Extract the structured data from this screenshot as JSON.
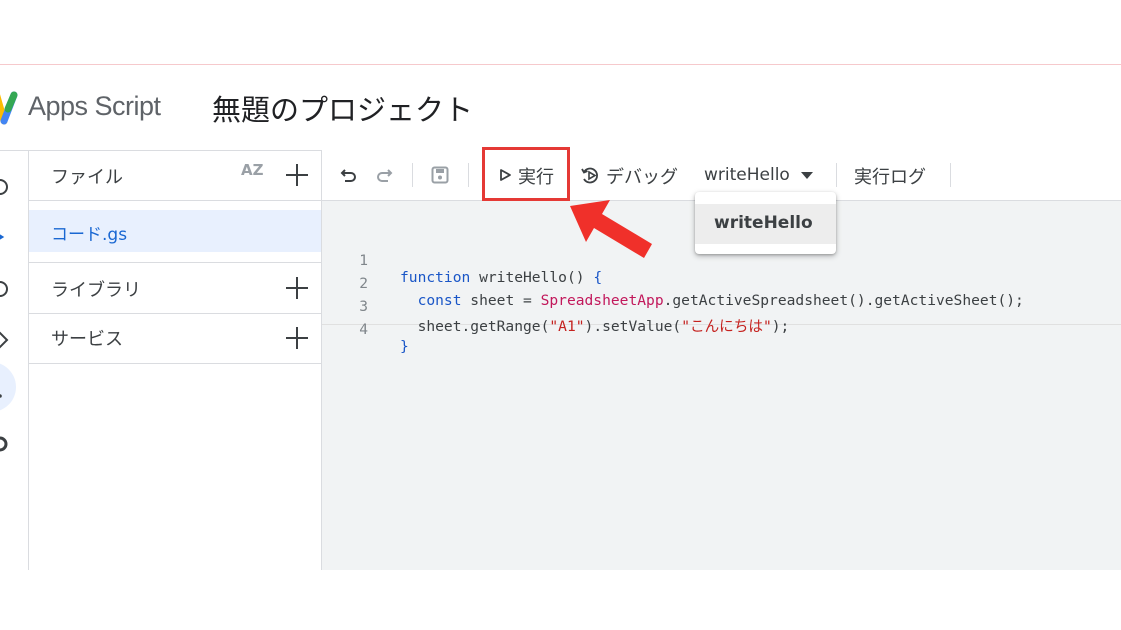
{
  "header": {
    "app_name": "Apps Script",
    "project_name": "無題のプロジェクト"
  },
  "files_panel": {
    "files_label": "ファイル",
    "sort_label": "AZ",
    "files": [
      {
        "name": "コード.gs"
      }
    ],
    "libraries_label": "ライブラリ",
    "services_label": "サービス"
  },
  "toolbar": {
    "run_label": "実行",
    "debug_label": "デバッグ",
    "function_selector": "writeHello",
    "log_label": "実行ログ"
  },
  "dropdown": {
    "items": [
      {
        "label": "writeHello"
      }
    ]
  },
  "code": {
    "lines": [
      {
        "number": "1",
        "text": "function writeHello() {"
      },
      {
        "number": "2",
        "text": "  const sheet = SpreadsheetApp.getActiveSpreadsheet().getActiveSheet();"
      },
      {
        "number": "3",
        "text": "  sheet.getRange(\"A1\").setValue(\"こんにちは\");"
      },
      {
        "number": "4",
        "text": "}"
      }
    ]
  },
  "colors": {
    "highlight_box": "#e53935",
    "arrow": "#f0302a",
    "active_file_bg": "#e8f0fe",
    "active_file_text": "#1967d2",
    "keyword": "#1a56c7",
    "class_name": "#c2185b",
    "string": "#c5221f"
  },
  "icons": [
    "apps-script-logo-icon",
    "undo-icon",
    "redo-icon",
    "save-icon",
    "play-icon",
    "debug-icon",
    "dropdown-caret-icon",
    "sort-az-icon",
    "add-icon",
    "red-arrow-annotation"
  ]
}
